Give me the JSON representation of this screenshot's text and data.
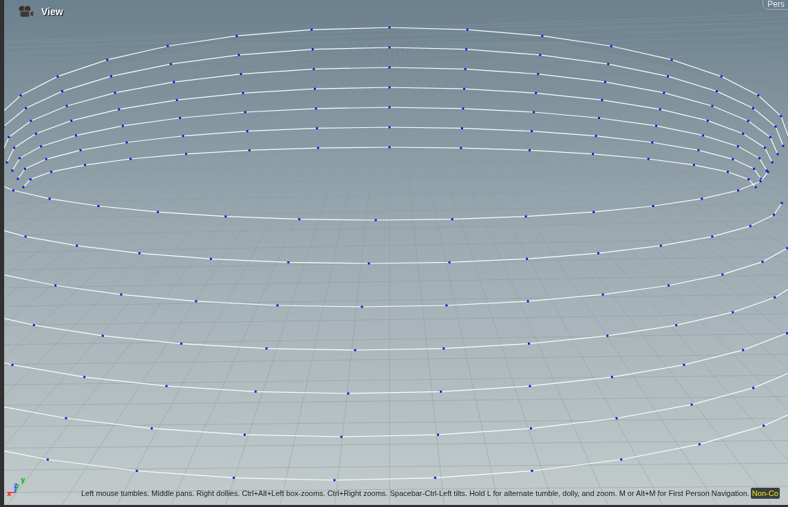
{
  "viewport": {
    "title": "View",
    "camera_menu": "Pers"
  },
  "axes": [
    {
      "label": "x",
      "color": "#ff2020"
    },
    {
      "label": "y",
      "color": "#00c000"
    },
    {
      "label": "z",
      "color": "#3050ff"
    }
  ],
  "hint": "Left mouse tumbles. Middle pans. Right dollies. Ctrl+Alt+Left box-zooms. Ctrl+Right zooms. Spacebar-Ctrl-Left tilts. Hold L for alternate tumble, dolly, and zoom. M or Alt+M for First Person Navigation.",
  "mode_label": "Non-Co"
}
